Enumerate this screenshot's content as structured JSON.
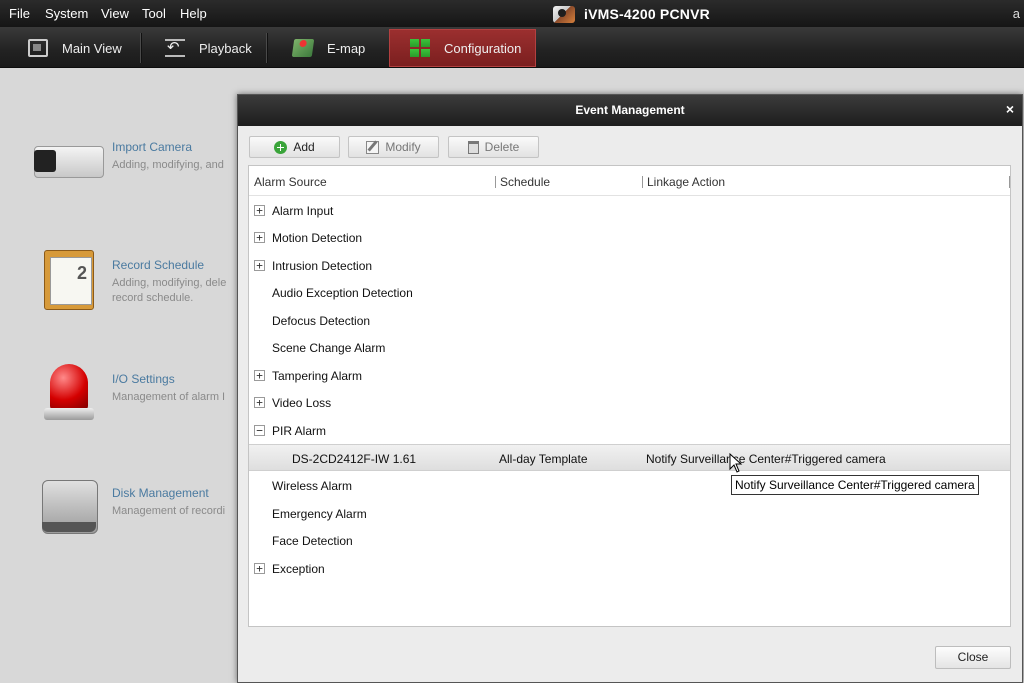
{
  "menu": {
    "items": [
      "File",
      "System",
      "View",
      "Tool",
      "Help"
    ],
    "app_title": "iVMS-4200  PCNVR",
    "user_initial": "a"
  },
  "tabs": [
    {
      "label": "Main View",
      "icon": "monitor-icon",
      "active": false
    },
    {
      "label": "Playback",
      "icon": "playback-icon",
      "active": false
    },
    {
      "label": "E-map",
      "icon": "map-icon",
      "active": false
    },
    {
      "label": "Configuration",
      "icon": "grid-icon",
      "active": true
    }
  ],
  "config_items": [
    {
      "title": "Import Camera",
      "desc": "Adding, modifying, and",
      "icon": "camera-icon"
    },
    {
      "title": "Record Schedule",
      "desc": "Adding, modifying, dele record schedule.",
      "icon": "schedule-icon"
    },
    {
      "title": "I/O Settings",
      "desc": "Management of alarm I",
      "icon": "alarm-light-icon"
    },
    {
      "title": "Disk Management",
      "desc": "Management of recordi",
      "icon": "disk-icon"
    }
  ],
  "dialog": {
    "title": "Event Management",
    "close_glyph": "×",
    "toolbar": {
      "add": "Add",
      "modify": "Modify",
      "delete": "Delete"
    },
    "columns": [
      "Alarm Source",
      "Schedule",
      "Linkage Action"
    ],
    "rows": [
      {
        "label": "Alarm Input",
        "expander": "+"
      },
      {
        "label": "Motion Detection",
        "expander": "+"
      },
      {
        "label": "Intrusion Detection",
        "expander": "+"
      },
      {
        "label": "Audio Exception Detection",
        "expander": ""
      },
      {
        "label": "Defocus Detection",
        "expander": ""
      },
      {
        "label": "Scene Change Alarm",
        "expander": ""
      },
      {
        "label": "Tampering Alarm",
        "expander": "+"
      },
      {
        "label": "Video Loss",
        "expander": "+"
      },
      {
        "label": "PIR Alarm",
        "expander": "−"
      }
    ],
    "pir_child": {
      "source": "DS-2CD2412F-IW 1.61",
      "schedule": "All-day Template",
      "linkage": "Notify Surveillance Center#Triggered camera"
    },
    "rows_after": [
      {
        "label": "Wireless Alarm",
        "expander": ""
      },
      {
        "label": "Emergency Alarm",
        "expander": ""
      },
      {
        "label": "Face Detection",
        "expander": ""
      },
      {
        "label": "Exception",
        "expander": "+"
      }
    ],
    "tooltip": "Notify Surveillance Center#Triggered camera",
    "close_button": "Close"
  },
  "colors": {
    "active_tab": "#8b2a2a",
    "config_title": "#4a7aa0",
    "add_icon": "#3aa43a"
  }
}
